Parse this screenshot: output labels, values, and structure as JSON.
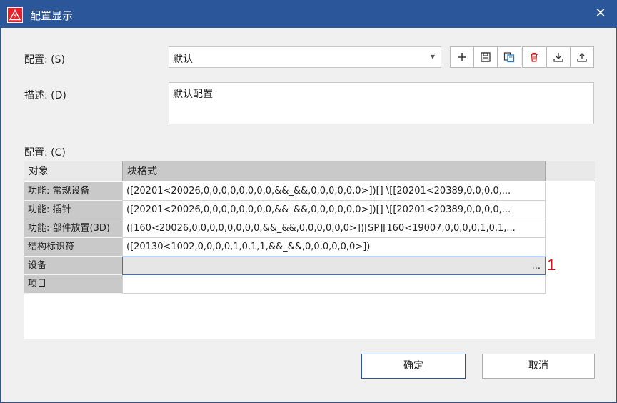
{
  "window": {
    "title": "配置显示",
    "close_glyph": "✕"
  },
  "config": {
    "label": "配置: (S)",
    "selected": "默认",
    "toolbar": [
      "plus-icon",
      "save-icon",
      "copy-icon",
      "delete-icon",
      "import-icon",
      "export-icon"
    ]
  },
  "description": {
    "label": "描述: (D)",
    "value": "默认配置"
  },
  "grid": {
    "label": "配置: (C)",
    "headers": [
      "对象",
      "块格式"
    ],
    "rows": [
      {
        "name": "功能: 常规设备",
        "value": "([20201<20026,0,0,0,0,0,0,0,0,&&_&&,0,0,0,0,0,0>])[] \\[[20201<20389,0,0,0,0,..."
      },
      {
        "name": "功能: 插针",
        "value": "([20201<20026,0,0,0,0,0,0,0,0,&&_&&,0,0,0,0,0,0>])[] \\[[20201<20389,0,0,0,0,..."
      },
      {
        "name": "功能: 部件放置(3D)",
        "value": "([160<20026,0,0,0,0,0,0,0,0,&&_&&,0,0,0,0,0,0>])[SP][160<19007,0,0,0,0,1,0,1,..."
      },
      {
        "name": "结构标识符",
        "value": "([20130<1002,0,0,0,0,1,0,1,1,&&_&&,0,0,0,0,0,0>])"
      },
      {
        "name": "设备",
        "value": "",
        "ellipsis": "..."
      },
      {
        "name": "项目",
        "value": ""
      }
    ]
  },
  "annotation": "1",
  "buttons": {
    "ok": "确定",
    "cancel": "取消"
  },
  "colors": {
    "titlebar": "#2b579a",
    "app_icon": "#e8202a",
    "annotation": "#d01818",
    "delete_icon": "#d01818"
  }
}
